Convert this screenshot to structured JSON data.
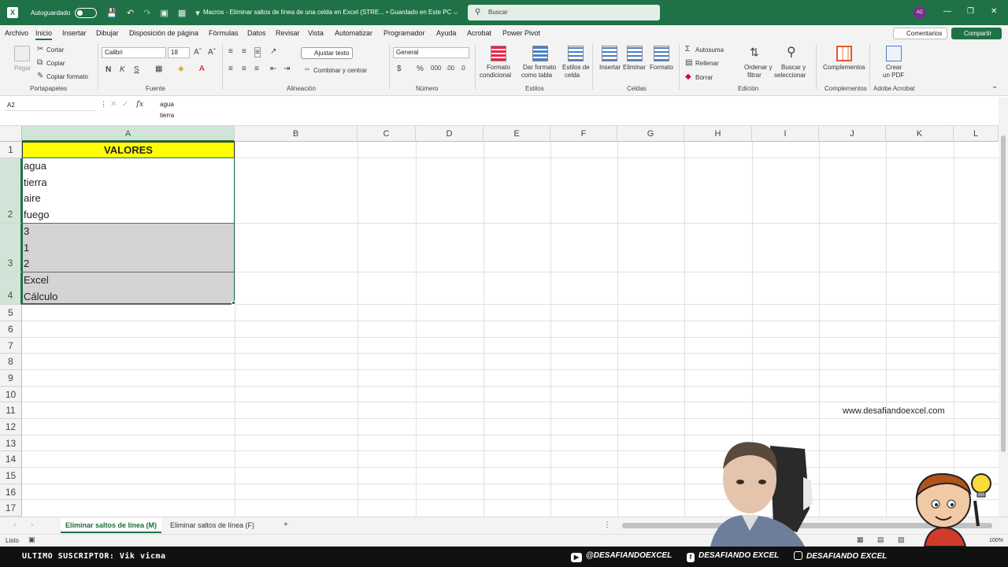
{
  "title_bar": {
    "autosave_label": "Autoguardado",
    "doc_title": "Macros - Eliminar saltos de línea de una celda en Excel (STRE...  •  Guardado en Este PC ⌵",
    "search_placeholder": "Buscar",
    "user_initials": "AC"
  },
  "menu": {
    "tabs": [
      "Archivo",
      "Inicio",
      "Insertar",
      "Dibujar",
      "Disposición de página",
      "Fórmulas",
      "Datos",
      "Revisar",
      "Vista",
      "Automatizar",
      "Programador",
      "Ayuda",
      "Acrobat",
      "Power Pivot"
    ],
    "active": "Inicio",
    "comments_label": "Comentarios",
    "share_label": "Compartir"
  },
  "ribbon": {
    "clipboard": {
      "paste": "Pegar",
      "cut": "Cortar",
      "copy": "Copiar",
      "format_painter": "Copiar formato",
      "group": "Portapapeles"
    },
    "font": {
      "name": "Calibri",
      "size": "18",
      "bold": "N",
      "italic": "K",
      "underline": "S",
      "group": "Fuente"
    },
    "alignment": {
      "wrap_text": "Ajustar texto",
      "merge_center": "Combinar y centrar",
      "group": "Alineación"
    },
    "number": {
      "format": "General",
      "group": "Número"
    },
    "styles": {
      "conditional_1": "Formato",
      "conditional_2": "condicional",
      "as_table_1": "Dar formato",
      "as_table_2": "como tabla",
      "cell_styles_1": "Estilos de",
      "cell_styles_2": "celda",
      "group": "Estilos"
    },
    "cells": {
      "insert": "Insertar",
      "delete": "Eliminar",
      "format": "Formato",
      "group": "Celdas"
    },
    "editing": {
      "autosum": "Autosuma",
      "fill": "Rellenar",
      "clear": "Borrar",
      "sort_1": "Ordenar y",
      "sort_2": "filtrar",
      "find_1": "Buscar y",
      "find_2": "seleccionar",
      "group": "Edición"
    },
    "addins": {
      "label": "Complementos",
      "group": "Complementos"
    },
    "acrobat": {
      "create_1": "Crear",
      "create_2": "un PDF",
      "group": "Adobe Acrobat"
    }
  },
  "formula_bar": {
    "name_box": "A2",
    "fx": "fx",
    "line1": "agua",
    "line2": "tierra"
  },
  "grid": {
    "columns": [
      "A",
      "B",
      "C",
      "D",
      "E",
      "F",
      "G",
      "H",
      "I",
      "J",
      "K",
      "L"
    ],
    "rows": [
      "1",
      "2",
      "3",
      "4",
      "5",
      "6",
      "7",
      "8",
      "9",
      "10",
      "11",
      "12",
      "13",
      "14",
      "15",
      "16",
      "17"
    ],
    "a1": "VALORES",
    "a2": [
      "agua",
      "tierra",
      "aire",
      "fuego"
    ],
    "a3": [
      "3",
      "1",
      "2"
    ],
    "a4": [
      "Excel",
      "Cálculo"
    ],
    "website": "www.desafiandoexcel.com"
  },
  "sheets": {
    "tab1": "Eliminar saltos de línea (M)",
    "tab2": "Eliminar saltos de línea (F)",
    "add": "+"
  },
  "status": {
    "ready": "Listo",
    "zoom": "100%"
  },
  "banner": {
    "subscriber": "ULTIMO SUSCRIPTOR: Vik vicma",
    "youtube": "@DESAFIANDOEXCEL",
    "facebook": "DESAFIANDO EXCEL",
    "instagram": "DESAFIANDO EXCEL"
  },
  "colors": {
    "excel_green": "#1f7246",
    "header_yellow": "#ffff00",
    "shade_gray": "#d4d4d4"
  }
}
